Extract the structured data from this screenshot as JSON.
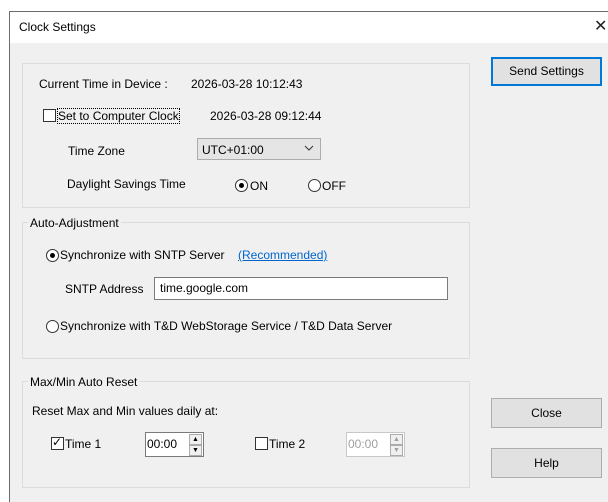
{
  "window": {
    "title": "Clock Settings",
    "close_glyph": "✕"
  },
  "clock_group": {
    "current_time_label": "Current Time in Device :",
    "current_time_value": "2026-03-28 10:12:43",
    "set_computer_clock_label": "Set to Computer Clock",
    "set_computer_clock_checked": false,
    "computer_time_value": "2026-03-28 09:12:44",
    "time_zone_label": "Time Zone",
    "time_zone_value": "UTC+01:00",
    "dst_label": "Daylight Savings Time",
    "dst_on_label": "ON",
    "dst_off_label": "OFF",
    "dst_selected": "ON"
  },
  "auto_adjust": {
    "legend": "Auto-Adjustment",
    "sntp_option_label": "Synchronize with SNTP Server",
    "recommended_link": "(Recommended)",
    "sntp_address_label": "SNTP Address",
    "sntp_address_value": "time.google.com",
    "webstorage_option_label": "Synchronize with T&D WebStorage Service / T&D Data Server",
    "selected": "sntp"
  },
  "maxmin": {
    "legend": "Max/Min Auto Reset",
    "reset_label": "Reset Max and Min values daily at:",
    "time1_label": "Time 1",
    "time1_checked": true,
    "time1_value": "00:00",
    "time2_label": "Time 2",
    "time2_checked": false,
    "time2_value": "00:00"
  },
  "buttons": {
    "send_settings": "Send Settings",
    "close": "Close",
    "help": "Help"
  }
}
